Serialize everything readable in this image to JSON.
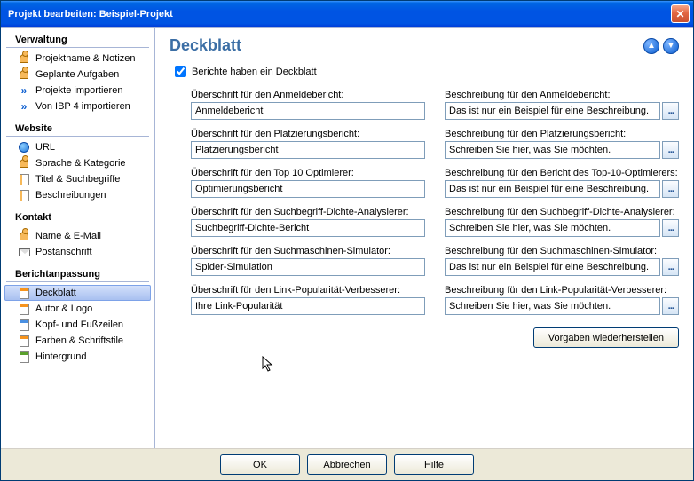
{
  "window": {
    "title": "Projekt bearbeiten: Beispiel-Projekt"
  },
  "sidebar": {
    "sections": [
      {
        "header": "Verwaltung",
        "items": [
          {
            "label": "Projektname & Notizen",
            "icon": "person"
          },
          {
            "label": "Geplante Aufgaben",
            "icon": "person"
          },
          {
            "label": "Projekte importieren",
            "icon": "arrow"
          },
          {
            "label": "Von IBP 4 importieren",
            "icon": "arrow"
          }
        ]
      },
      {
        "header": "Website",
        "items": [
          {
            "label": "URL",
            "icon": "globe"
          },
          {
            "label": "Sprache & Kategorie",
            "icon": "person"
          },
          {
            "label": "Titel & Suchbegriffe",
            "icon": "page"
          },
          {
            "label": "Beschreibungen",
            "icon": "page"
          }
        ]
      },
      {
        "header": "Kontakt",
        "items": [
          {
            "label": "Name & E-Mail",
            "icon": "person"
          },
          {
            "label": "Postanschrift",
            "icon": "mail"
          }
        ]
      },
      {
        "header": "Berichtanpassung",
        "items": [
          {
            "label": "Deckblatt",
            "icon": "doc-orange",
            "selected": true
          },
          {
            "label": "Autor & Logo",
            "icon": "doc-orange"
          },
          {
            "label": "Kopf- und Fußzeilen",
            "icon": "doc-blue"
          },
          {
            "label": "Farben & Schriftstile",
            "icon": "doc-orange"
          },
          {
            "label": "Hintergrund",
            "icon": "doc-green"
          }
        ]
      }
    ]
  },
  "main": {
    "title": "Deckblatt",
    "checkbox_label": "Berichte haben ein Deckblatt",
    "checkbox_checked": true,
    "rows": [
      {
        "left_label": "Überschrift für den Anmeldebericht:",
        "left_value": "Anmeldebericht",
        "right_label": "Beschreibung für den Anmeldebericht:",
        "right_value": "Das ist nur ein Beispiel für eine Beschreibung."
      },
      {
        "left_label": "Überschrift für den Platzierungsbericht:",
        "left_value": "Platzierungsbericht",
        "right_label": "Beschreibung für den Platzierungsbericht:",
        "right_value": "Schreiben Sie hier, was Sie möchten."
      },
      {
        "left_label": "Überschrift für den Top 10 Optimierer:",
        "left_value": "Optimierungsbericht",
        "right_label": "Beschreibung für den Bericht des Top-10-Optimierers:",
        "right_value": "Das ist nur ein Beispiel für eine Beschreibung."
      },
      {
        "left_label": "Überschrift für den Suchbegriff-Dichte-Analysierer:",
        "left_value": "Suchbegriff-Dichte-Bericht",
        "right_label": "Beschreibung für den Suchbegriff-Dichte-Analysierer:",
        "right_value": "Schreiben Sie hier, was Sie möchten."
      },
      {
        "left_label": "Überschrift für den Suchmaschinen-Simulator:",
        "left_value": "Spider-Simulation",
        "right_label": "Beschreibung für den Suchmaschinen-Simulator:",
        "right_value": "Das ist nur ein Beispiel für eine Beschreibung."
      },
      {
        "left_label": "Überschrift für den Link-Popularität-Verbesserer:",
        "left_value": "Ihre Link-Popularität",
        "right_label": "Beschreibung für den Link-Popularität-Verbesserer:",
        "right_value": "Schreiben Sie hier, was Sie möchten."
      }
    ],
    "restore_button": "Vorgaben wiederherstellen"
  },
  "footer": {
    "ok": "OK",
    "cancel": "Abbrechen",
    "help": "Hilfe"
  }
}
